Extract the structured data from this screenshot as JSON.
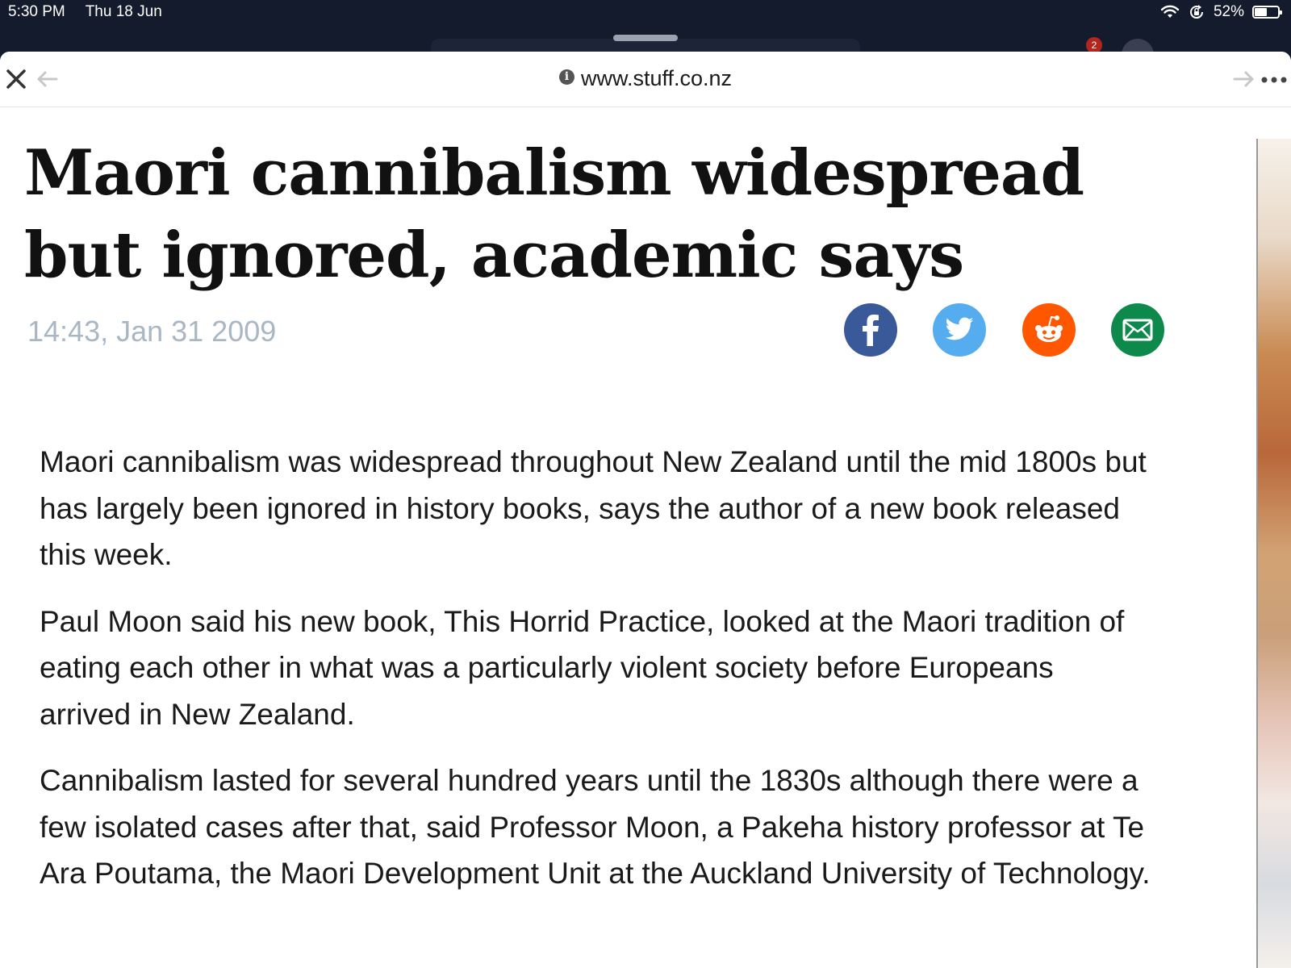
{
  "status_bar": {
    "time": "5:30 PM",
    "date": "Thu 18 Jun",
    "battery_percent": "52%",
    "battery_level": 0.52,
    "notification_count": "2"
  },
  "browser": {
    "url": "www.stuff.co.nz",
    "close_icon": "close-icon",
    "back_icon": "back-arrow-icon",
    "forward_icon": "forward-arrow-icon",
    "more_icon": "more-icon"
  },
  "article": {
    "headline_line1": "Maori cannibalism widespread",
    "headline_line2": "but ignored, academic says",
    "timestamp": "14:43, Jan 31 2009",
    "paragraphs": [
      "Maori cannibalism was widespread throughout New Zealand until the mid 1800s but has largely been ignored in history books, says the author of a new book released this week.",
      "Paul Moon said his new book, This Horrid Practice, looked at the Maori tradition of eating each other in what was a particularly violent society before Europeans arrived in New Zealand.",
      "Cannibalism lasted for several hundred years until the 1830s although there were a few isolated cases after that, said Professor Moon, a Pakeha history professor at Te Ara Poutama, the Maori Development Unit at the Auckland University of Technology."
    ]
  },
  "share_buttons": [
    {
      "icon": "facebook-icon",
      "color": "#3a5998"
    },
    {
      "icon": "twitter-icon",
      "color": "#55acee"
    },
    {
      "icon": "reddit-icon",
      "color": "#ff5700"
    },
    {
      "icon": "email-icon",
      "color": "#0d8a4b"
    }
  ]
}
